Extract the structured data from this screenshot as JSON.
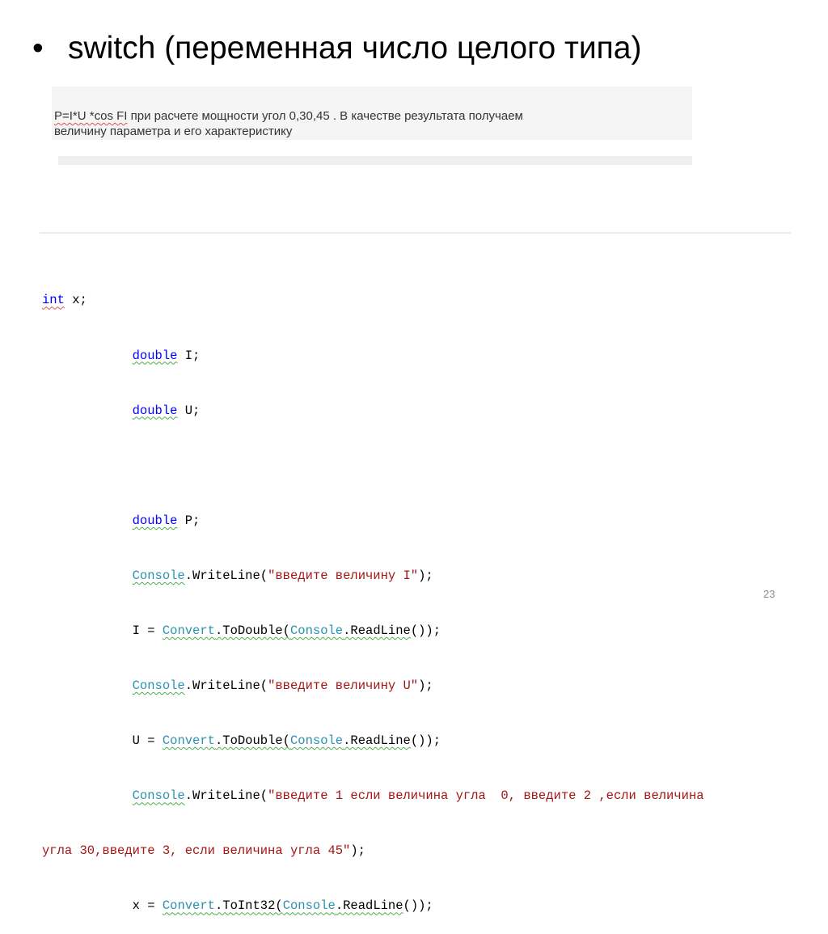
{
  "slide": {
    "bullet": "•",
    "title": "switch (переменная число целого типа)",
    "description": {
      "formula": "P=I*U *cos FI",
      "rest_line1": "   при расчете мощности  угол 0,30,45 . В качестве результата получаем",
      "line2": "величину параметра и его характеристику"
    },
    "code": {
      "l1_kw": "int",
      "l1_rest": " x;",
      "l2_kw": "double",
      "l2_rest": " I;",
      "l3_kw": "double",
      "l3_rest": " U;",
      "l5_kw": "double",
      "l5_rest": " P;",
      "console": "Console",
      "convert": "Convert",
      "writeline": ".WriteLine(",
      "readline": ".ReadLine",
      "todouble": ".ToDouble(",
      "toint32": ".ToInt32(",
      "str_i": "\"введите величину I\"",
      "str_u": "\"введите величину U\"",
      "str_angle_a": "\"введите 1 если величина угла  0, введите 2 ,если величина",
      "str_angle_b": "угла 30,введите 3, если величина угла 45\"",
      "close_stmt": ");",
      "i_assign": "I = ",
      "u_assign": "U = ",
      "x_assign": "x = ",
      "read_close": "());"
    },
    "page_number": "23"
  }
}
